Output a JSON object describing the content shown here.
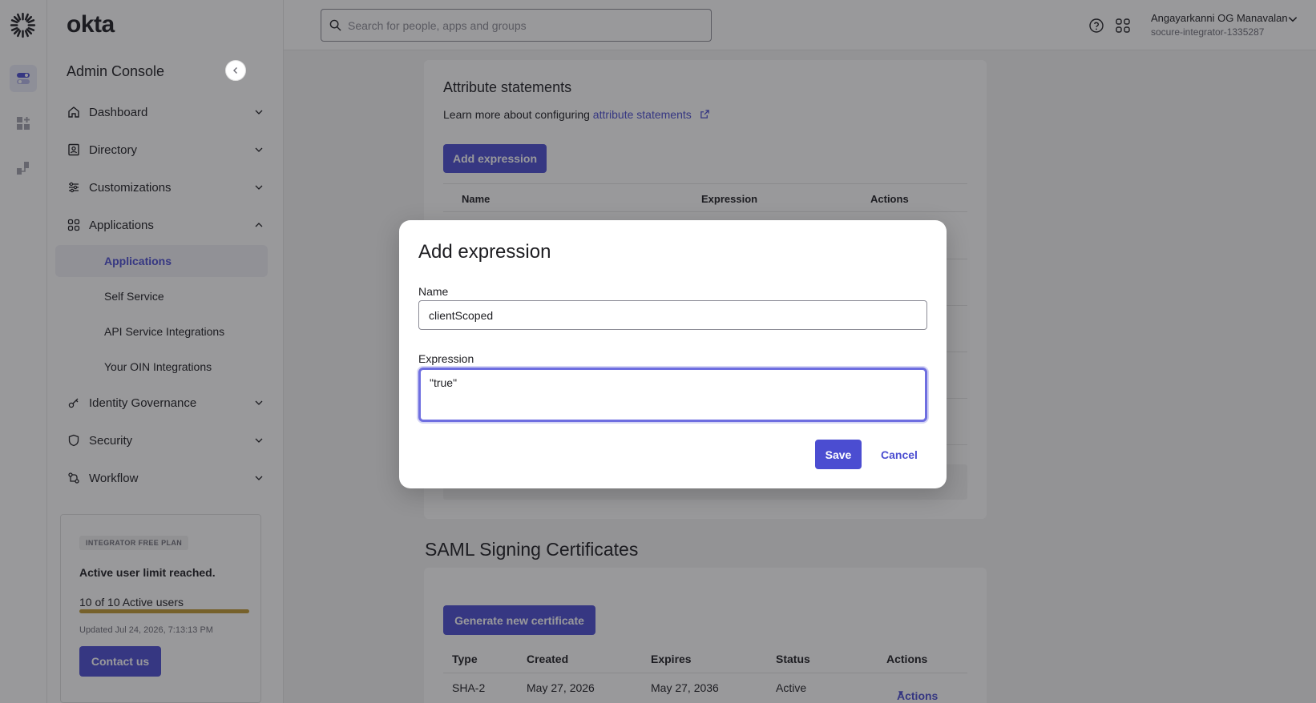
{
  "brand": {
    "name": "okta",
    "console_title": "Admin Console"
  },
  "rail": {
    "items": [
      {
        "icon": "toggle-icon",
        "active": true
      },
      {
        "icon": "grid-plus-icon",
        "active": false
      },
      {
        "icon": "integration-icon",
        "active": false
      }
    ]
  },
  "sidebar": {
    "items": [
      {
        "label": "Dashboard",
        "icon": "home-icon",
        "expanded": false
      },
      {
        "label": "Directory",
        "icon": "directory-icon",
        "expanded": false
      },
      {
        "label": "Customizations",
        "icon": "sliders-icon",
        "expanded": false
      },
      {
        "label": "Applications",
        "icon": "apps-grid-icon",
        "expanded": true
      },
      {
        "label": "Identity Governance",
        "icon": "key-icon",
        "expanded": false
      },
      {
        "label": "Security",
        "icon": "shield-icon",
        "expanded": false
      },
      {
        "label": "Workflow",
        "icon": "workflow-icon",
        "expanded": false
      }
    ],
    "sub_items": [
      {
        "label": "Applications",
        "active": true
      },
      {
        "label": "Self Service",
        "active": false
      },
      {
        "label": "API Service Integrations",
        "active": false
      },
      {
        "label": "Your OIN Integrations",
        "active": false
      }
    ]
  },
  "plan": {
    "badge": "INTEGRATOR FREE PLAN",
    "warning": "Active user limit reached.",
    "usage": "10 of 10 Active users",
    "usage_fraction": 1.0,
    "updated": "Updated Jul 24, 2026, 7:13:13 PM",
    "contact_label": "Contact us"
  },
  "topbar": {
    "search_placeholder": "Search for people, apps and groups",
    "user_name": "Angayarkanni OG Manavalan",
    "user_org": "socure-integrator-1335287"
  },
  "attributes": {
    "title": "Attribute statements",
    "learn_prefix": "Learn more about configuring ",
    "learn_link": "attribute statements",
    "add_label": "Add expression",
    "columns": [
      "Name",
      "Expression",
      "Actions"
    ]
  },
  "saml": {
    "title": "SAML Signing Certificates",
    "generate_label": "Generate new certificate",
    "columns": [
      "Type",
      "Created",
      "Expires",
      "Status",
      "Actions"
    ],
    "rows": [
      {
        "type": "SHA-2",
        "created": "May 27, 2026",
        "expires": "May 27, 2036",
        "status": "Active",
        "actions": "Actions"
      }
    ]
  },
  "modal": {
    "title": "Add expression",
    "name_label": "Name",
    "name_value": "clientScoped",
    "expression_label": "Expression",
    "expression_value": "\"true\"",
    "save_label": "Save",
    "cancel_label": "Cancel"
  },
  "colors": {
    "accent": "#4b4dd1",
    "progress": "#c09a33",
    "text": "#1d1d21"
  }
}
